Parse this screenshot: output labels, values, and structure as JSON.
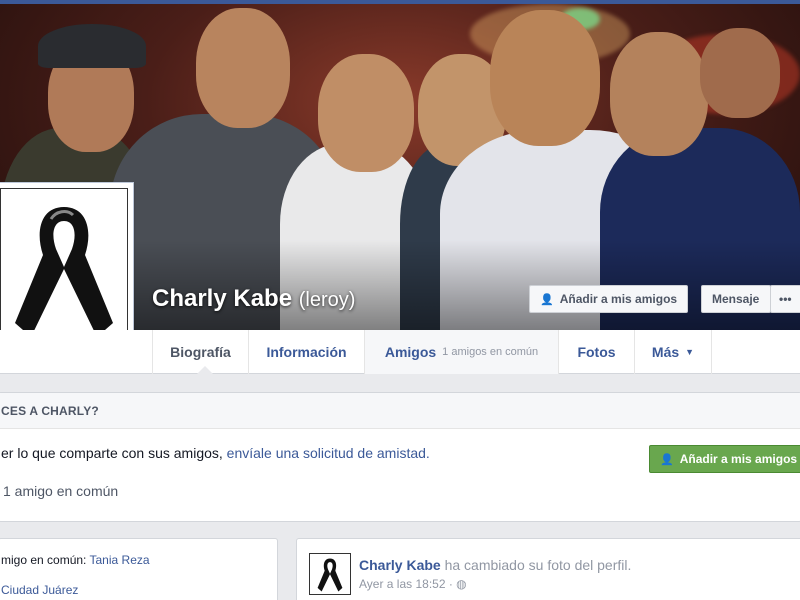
{
  "profile": {
    "name": "Charly Kabe",
    "alternate_name": "(leroy)"
  },
  "cover_buttons": {
    "add_friend": "Añadir a mis amigos",
    "message": "Mensaje",
    "more": "•••"
  },
  "tabs": [
    {
      "label": "Biografía"
    },
    {
      "label": "Información"
    },
    {
      "label": "Amigos",
      "sub": "1 amigos en común"
    },
    {
      "label": "Fotos"
    },
    {
      "label": "Más",
      "caret": "▼"
    }
  ],
  "know_box": {
    "header": "CES A CHARLY?",
    "text_prefix": "er lo que comparte con sus amigos, ",
    "text_link": "envíale una solicitud de amistad.",
    "mutual": "1 amigo en común",
    "add_friend_button": "Añadir a mis amigos"
  },
  "left_info": {
    "mutual_prefix": "migo en común: ",
    "mutual_name": "Tania Reza",
    "city": "Ciudad Juárez"
  },
  "story": {
    "author": "Charly Kabe",
    "action": " ha cambiado su foto del perfil.",
    "meta": "Ayer a las 18:52 · ",
    "privacy_icon": "globe-icon"
  },
  "colors": {
    "brand_blue": "#3b5998",
    "green_button": "#69a74e"
  }
}
